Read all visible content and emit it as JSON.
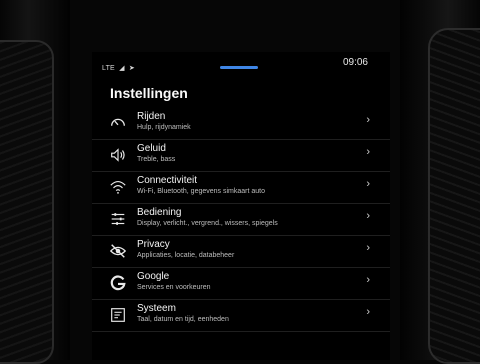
{
  "status": {
    "network": "LTE",
    "clock": "09:06"
  },
  "page": {
    "title": "Instellingen"
  },
  "items": [
    {
      "title": "Rijden",
      "subtitle": "Hulp, rijdynamiek",
      "icon": "speedometer-icon"
    },
    {
      "title": "Geluid",
      "subtitle": "Treble, bass",
      "icon": "speaker-icon"
    },
    {
      "title": "Connectiviteit",
      "subtitle": "Wi-Fi, Bluetooth, gegevens simkaart auto",
      "icon": "wifi-icon"
    },
    {
      "title": "Bediening",
      "subtitle": "Display, verlicht., vergrend., wissers, spiegels",
      "icon": "sliders-icon"
    },
    {
      "title": "Privacy",
      "subtitle": "Applicaties, locatie, databeheer",
      "icon": "eye-slash-icon"
    },
    {
      "title": "Google",
      "subtitle": "Services en voorkeuren",
      "icon": "google-icon"
    },
    {
      "title": "Systeem",
      "subtitle": "Taal, datum en tijd, eenheden",
      "icon": "system-icon"
    }
  ],
  "colors": {
    "accent": "#3f86e6",
    "background": "#000000",
    "text": "#f4f4f4"
  }
}
